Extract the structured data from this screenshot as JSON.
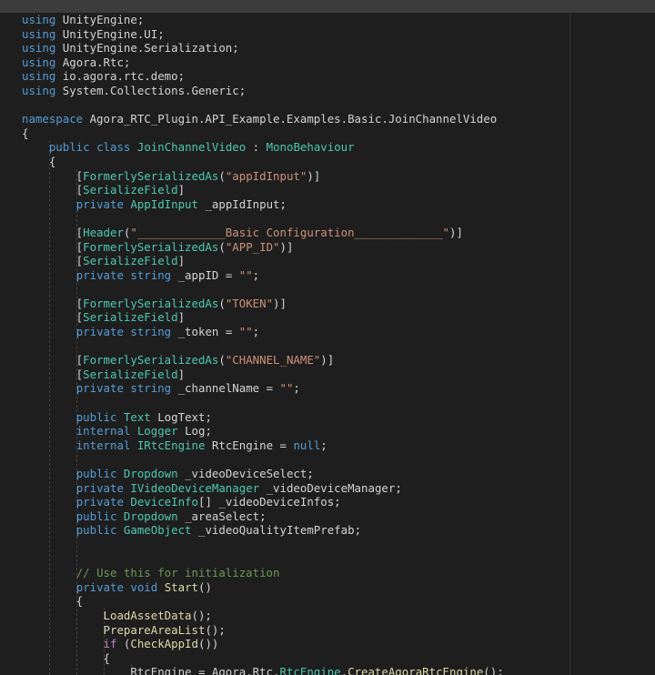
{
  "editor": {
    "language": "csharp",
    "colors": {
      "background": "#1e1e1e",
      "keyword": "#569cd6",
      "type": "#4ec9b0",
      "string": "#ce9178",
      "function": "#dcdcaa",
      "comment": "#6a9955",
      "control": "#c586c0",
      "text": "#d4d4d4"
    },
    "lines": [
      [
        {
          "c": "kw",
          "t": "using"
        },
        {
          "c": "id",
          "t": " UnityEngine;"
        }
      ],
      [
        {
          "c": "kw",
          "t": "using"
        },
        {
          "c": "id",
          "t": " UnityEngine.UI;"
        }
      ],
      [
        {
          "c": "kw",
          "t": "using"
        },
        {
          "c": "id",
          "t": " UnityEngine.Serialization;"
        }
      ],
      [
        {
          "c": "kw",
          "t": "using"
        },
        {
          "c": "id",
          "t": " Agora.Rtc;"
        }
      ],
      [
        {
          "c": "kw",
          "t": "using"
        },
        {
          "c": "id",
          "t": " io.agora.rtc.demo;"
        }
      ],
      [
        {
          "c": "kw",
          "t": "using"
        },
        {
          "c": "id",
          "t": " System.Collections.Generic;"
        }
      ],
      [],
      [
        {
          "c": "kw",
          "t": "namespace"
        },
        {
          "c": "id",
          "t": " Agora_RTC_Plugin.API_Example.Examples.Basic.JoinChannelVideo"
        }
      ],
      [
        {
          "c": "id",
          "t": "{"
        }
      ],
      [
        {
          "c": "id",
          "t": "    "
        },
        {
          "c": "kw",
          "t": "public"
        },
        {
          "c": "id",
          "t": " "
        },
        {
          "c": "kw",
          "t": "class"
        },
        {
          "c": "id",
          "t": " "
        },
        {
          "c": "ty",
          "t": "JoinChannelVideo"
        },
        {
          "c": "id",
          "t": " : "
        },
        {
          "c": "ty",
          "t": "MonoBehaviour"
        }
      ],
      [
        {
          "c": "id",
          "t": "    {"
        }
      ],
      [
        {
          "c": "id",
          "t": "        ["
        },
        {
          "c": "ty",
          "t": "FormerlySerializedAs"
        },
        {
          "c": "id",
          "t": "("
        },
        {
          "c": "st",
          "t": "\"appIdInput\""
        },
        {
          "c": "id",
          "t": ")]"
        }
      ],
      [
        {
          "c": "id",
          "t": "        ["
        },
        {
          "c": "ty",
          "t": "SerializeField"
        },
        {
          "c": "id",
          "t": "]"
        }
      ],
      [
        {
          "c": "id",
          "t": "        "
        },
        {
          "c": "kw",
          "t": "private"
        },
        {
          "c": "id",
          "t": " "
        },
        {
          "c": "ty",
          "t": "AppIdInput"
        },
        {
          "c": "id",
          "t": " _appIdInput;"
        }
      ],
      [],
      [
        {
          "c": "id",
          "t": "        ["
        },
        {
          "c": "ty",
          "t": "Header"
        },
        {
          "c": "id",
          "t": "("
        },
        {
          "c": "st",
          "t": "\"_____________Basic Configuration_____________\""
        },
        {
          "c": "id",
          "t": ")]"
        }
      ],
      [
        {
          "c": "id",
          "t": "        ["
        },
        {
          "c": "ty",
          "t": "FormerlySerializedAs"
        },
        {
          "c": "id",
          "t": "("
        },
        {
          "c": "st",
          "t": "\"APP_ID\""
        },
        {
          "c": "id",
          "t": ")]"
        }
      ],
      [
        {
          "c": "id",
          "t": "        ["
        },
        {
          "c": "ty",
          "t": "SerializeField"
        },
        {
          "c": "id",
          "t": "]"
        }
      ],
      [
        {
          "c": "id",
          "t": "        "
        },
        {
          "c": "kw",
          "t": "private"
        },
        {
          "c": "id",
          "t": " "
        },
        {
          "c": "kw",
          "t": "string"
        },
        {
          "c": "id",
          "t": " _appID = "
        },
        {
          "c": "st",
          "t": "\"\""
        },
        {
          "c": "id",
          "t": ";"
        }
      ],
      [],
      [
        {
          "c": "id",
          "t": "        ["
        },
        {
          "c": "ty",
          "t": "FormerlySerializedAs"
        },
        {
          "c": "id",
          "t": "("
        },
        {
          "c": "st",
          "t": "\"TOKEN\""
        },
        {
          "c": "id",
          "t": ")]"
        }
      ],
      [
        {
          "c": "id",
          "t": "        ["
        },
        {
          "c": "ty",
          "t": "SerializeField"
        },
        {
          "c": "id",
          "t": "]"
        }
      ],
      [
        {
          "c": "id",
          "t": "        "
        },
        {
          "c": "kw",
          "t": "private"
        },
        {
          "c": "id",
          "t": " "
        },
        {
          "c": "kw",
          "t": "string"
        },
        {
          "c": "id",
          "t": " _token = "
        },
        {
          "c": "st",
          "t": "\"\""
        },
        {
          "c": "id",
          "t": ";"
        }
      ],
      [],
      [
        {
          "c": "id",
          "t": "        ["
        },
        {
          "c": "ty",
          "t": "FormerlySerializedAs"
        },
        {
          "c": "id",
          "t": "("
        },
        {
          "c": "st",
          "t": "\"CHANNEL_NAME\""
        },
        {
          "c": "id",
          "t": ")]"
        }
      ],
      [
        {
          "c": "id",
          "t": "        ["
        },
        {
          "c": "ty",
          "t": "SerializeField"
        },
        {
          "c": "id",
          "t": "]"
        }
      ],
      [
        {
          "c": "id",
          "t": "        "
        },
        {
          "c": "kw",
          "t": "private"
        },
        {
          "c": "id",
          "t": " "
        },
        {
          "c": "kw",
          "t": "string"
        },
        {
          "c": "id",
          "t": " _channelName = "
        },
        {
          "c": "st",
          "t": "\"\""
        },
        {
          "c": "id",
          "t": ";"
        }
      ],
      [],
      [
        {
          "c": "id",
          "t": "        "
        },
        {
          "c": "kw",
          "t": "public"
        },
        {
          "c": "id",
          "t": " "
        },
        {
          "c": "ty",
          "t": "Text"
        },
        {
          "c": "id",
          "t": " LogText;"
        }
      ],
      [
        {
          "c": "id",
          "t": "        "
        },
        {
          "c": "kw",
          "t": "internal"
        },
        {
          "c": "id",
          "t": " "
        },
        {
          "c": "ty",
          "t": "Logger"
        },
        {
          "c": "id",
          "t": " Log;"
        }
      ],
      [
        {
          "c": "id",
          "t": "        "
        },
        {
          "c": "kw",
          "t": "internal"
        },
        {
          "c": "id",
          "t": " "
        },
        {
          "c": "ty",
          "t": "IRtcEngine"
        },
        {
          "c": "id",
          "t": " RtcEngine = "
        },
        {
          "c": "kw",
          "t": "null"
        },
        {
          "c": "id",
          "t": ";"
        }
      ],
      [],
      [
        {
          "c": "id",
          "t": "        "
        },
        {
          "c": "kw",
          "t": "public"
        },
        {
          "c": "id",
          "t": " "
        },
        {
          "c": "ty",
          "t": "Dropdown"
        },
        {
          "c": "id",
          "t": " _videoDeviceSelect;"
        }
      ],
      [
        {
          "c": "id",
          "t": "        "
        },
        {
          "c": "kw",
          "t": "private"
        },
        {
          "c": "id",
          "t": " "
        },
        {
          "c": "ty",
          "t": "IVideoDeviceManager"
        },
        {
          "c": "id",
          "t": " _videoDeviceManager;"
        }
      ],
      [
        {
          "c": "id",
          "t": "        "
        },
        {
          "c": "kw",
          "t": "private"
        },
        {
          "c": "id",
          "t": " "
        },
        {
          "c": "ty",
          "t": "DeviceInfo"
        },
        {
          "c": "id",
          "t": "[] _videoDeviceInfos;"
        }
      ],
      [
        {
          "c": "id",
          "t": "        "
        },
        {
          "c": "kw",
          "t": "public"
        },
        {
          "c": "id",
          "t": " "
        },
        {
          "c": "ty",
          "t": "Dropdown"
        },
        {
          "c": "id",
          "t": " _areaSelect;"
        }
      ],
      [
        {
          "c": "id",
          "t": "        "
        },
        {
          "c": "kw",
          "t": "public"
        },
        {
          "c": "id",
          "t": " "
        },
        {
          "c": "ty",
          "t": "GameObject"
        },
        {
          "c": "id",
          "t": " _videoQualityItemPrefab;"
        }
      ],
      [],
      [],
      [
        {
          "c": "id",
          "t": "        "
        },
        {
          "c": "cm",
          "t": "// Use this for initialization"
        }
      ],
      [
        {
          "c": "id",
          "t": "        "
        },
        {
          "c": "kw",
          "t": "private"
        },
        {
          "c": "id",
          "t": " "
        },
        {
          "c": "kw",
          "t": "void"
        },
        {
          "c": "id",
          "t": " "
        },
        {
          "c": "fn",
          "t": "Start"
        },
        {
          "c": "id",
          "t": "()"
        }
      ],
      [
        {
          "c": "id",
          "t": "        {"
        }
      ],
      [
        {
          "c": "id",
          "t": "            "
        },
        {
          "c": "fn",
          "t": "LoadAssetData"
        },
        {
          "c": "id",
          "t": "();"
        }
      ],
      [
        {
          "c": "id",
          "t": "            "
        },
        {
          "c": "fn",
          "t": "PrepareAreaList"
        },
        {
          "c": "id",
          "t": "();"
        }
      ],
      [
        {
          "c": "id",
          "t": "            "
        },
        {
          "c": "ctl",
          "t": "if"
        },
        {
          "c": "id",
          "t": " ("
        },
        {
          "c": "fn",
          "t": "CheckAppId"
        },
        {
          "c": "id",
          "t": "())"
        }
      ],
      [
        {
          "c": "id",
          "t": "            {"
        }
      ],
      [
        {
          "c": "id",
          "t": "                RtcEngine = Agora.Rtc."
        },
        {
          "c": "ty",
          "t": "RtcEngine"
        },
        {
          "c": "id",
          "t": "."
        },
        {
          "c": "fn",
          "t": "CreateAgoraRtcEngine"
        },
        {
          "c": "id",
          "t": "();"
        }
      ]
    ]
  }
}
